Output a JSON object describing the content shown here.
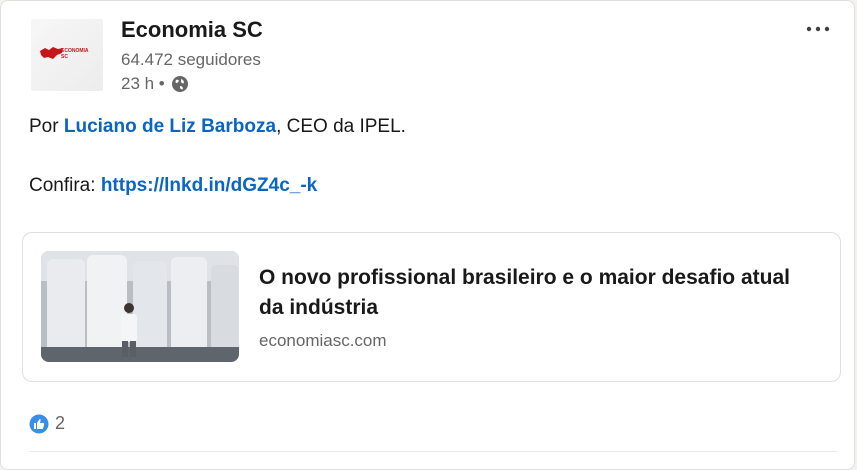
{
  "post": {
    "author": {
      "name": "Economia SC",
      "followers": "64.472 seguidores",
      "time": "23 h •",
      "logo_text_line1": "ECONOMIA",
      "logo_text_line2": "SC"
    },
    "body": {
      "line1_prefix": "Por ",
      "line1_mention": "Luciano de Liz Barboza",
      "line1_suffix": ", CEO da IPEL.",
      "line2_prefix": "Confira: ",
      "line2_link": "https://lnkd.in/dGZ4c_-k"
    },
    "article": {
      "title": "O novo profissional brasileiro e o maior desafio atual da indústria",
      "domain": "economiasc.com"
    },
    "reactions": {
      "count": "2",
      "icon": "like-icon"
    }
  },
  "colors": {
    "link": "#0a66c2",
    "brand_red": "#c4161c",
    "muted": "#666666"
  }
}
